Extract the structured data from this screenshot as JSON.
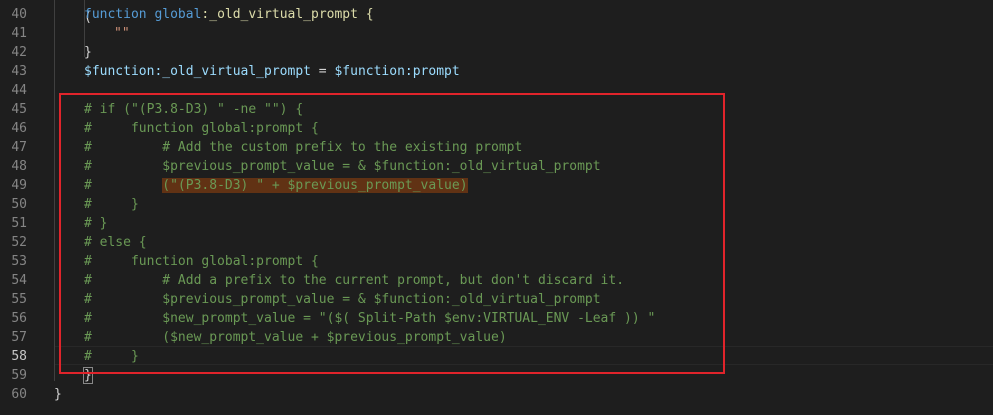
{
  "editor": {
    "accent": "#e0242b",
    "highlight_color": "#613214",
    "top_partial": "(",
    "lines": [
      {
        "num": "40",
        "parts": [
          {
            "t": "function",
            "c": "kw"
          },
          {
            "t": " ",
            "c": ""
          },
          {
            "t": "global",
            "c": "kw"
          },
          {
            "t": ":_old_virtual_prompt {",
            "c": "fn"
          }
        ]
      },
      {
        "num": "41",
        "parts": [
          {
            "t": "\"\"",
            "c": "str"
          }
        ]
      },
      {
        "num": "42",
        "parts": [
          {
            "t": "}",
            "c": ""
          }
        ]
      },
      {
        "num": "43",
        "parts": [
          {
            "t": "$function:_old_virtual_prompt",
            "c": "var"
          },
          {
            "t": " = ",
            "c": ""
          },
          {
            "t": "$function:prompt",
            "c": "var"
          }
        ]
      },
      {
        "num": "44",
        "parts": []
      },
      {
        "num": "45",
        "parts": [
          {
            "t": "# if (\"(P3.8-D3) \" -ne \"\") {",
            "c": "cm"
          }
        ]
      },
      {
        "num": "46",
        "parts": [
          {
            "t": "#     function global:prompt {",
            "c": "cm"
          }
        ]
      },
      {
        "num": "47",
        "parts": [
          {
            "t": "#         # Add the custom prefix to the existing prompt",
            "c": "cm"
          }
        ]
      },
      {
        "num": "48",
        "parts": [
          {
            "t": "#         $previous_prompt_value = & $function:_old_virtual_prompt",
            "c": "cm"
          }
        ]
      },
      {
        "num": "49",
        "parts": [
          {
            "t": "#         ",
            "c": "cm"
          },
          {
            "t": "(\"(P3.8-D3) \" + $previous_prompt_value)",
            "c": "cm hl"
          }
        ]
      },
      {
        "num": "50",
        "parts": [
          {
            "t": "#     }",
            "c": "cm"
          }
        ]
      },
      {
        "num": "51",
        "parts": [
          {
            "t": "# }",
            "c": "cm"
          }
        ]
      },
      {
        "num": "52",
        "parts": [
          {
            "t": "# else {",
            "c": "cm"
          }
        ]
      },
      {
        "num": "53",
        "parts": [
          {
            "t": "#     function global:prompt {",
            "c": "cm"
          }
        ]
      },
      {
        "num": "54",
        "parts": [
          {
            "t": "#         # Add a prefix to the current prompt, but don't discard it.",
            "c": "cm"
          }
        ]
      },
      {
        "num": "55",
        "parts": [
          {
            "t": "#         $previous_prompt_value = & $function:_old_virtual_prompt",
            "c": "cm"
          }
        ]
      },
      {
        "num": "56",
        "parts": [
          {
            "t": "#         $new_prompt_value = \"($( Split-Path $env:VIRTUAL_ENV -Leaf )) \"",
            "c": "cm"
          }
        ]
      },
      {
        "num": "57",
        "parts": [
          {
            "t": "#         ($new_prompt_value + $previous_prompt_value)",
            "c": "cm"
          }
        ]
      },
      {
        "num": "58",
        "parts": [
          {
            "t": "#     }",
            "c": "cm"
          }
        ],
        "active": true
      },
      {
        "num": "59",
        "parts": [
          {
            "t": "}",
            "c": "brace-box"
          }
        ]
      },
      {
        "num": "60",
        "parts": [
          {
            "t": "}",
            "c": ""
          }
        ]
      }
    ]
  }
}
